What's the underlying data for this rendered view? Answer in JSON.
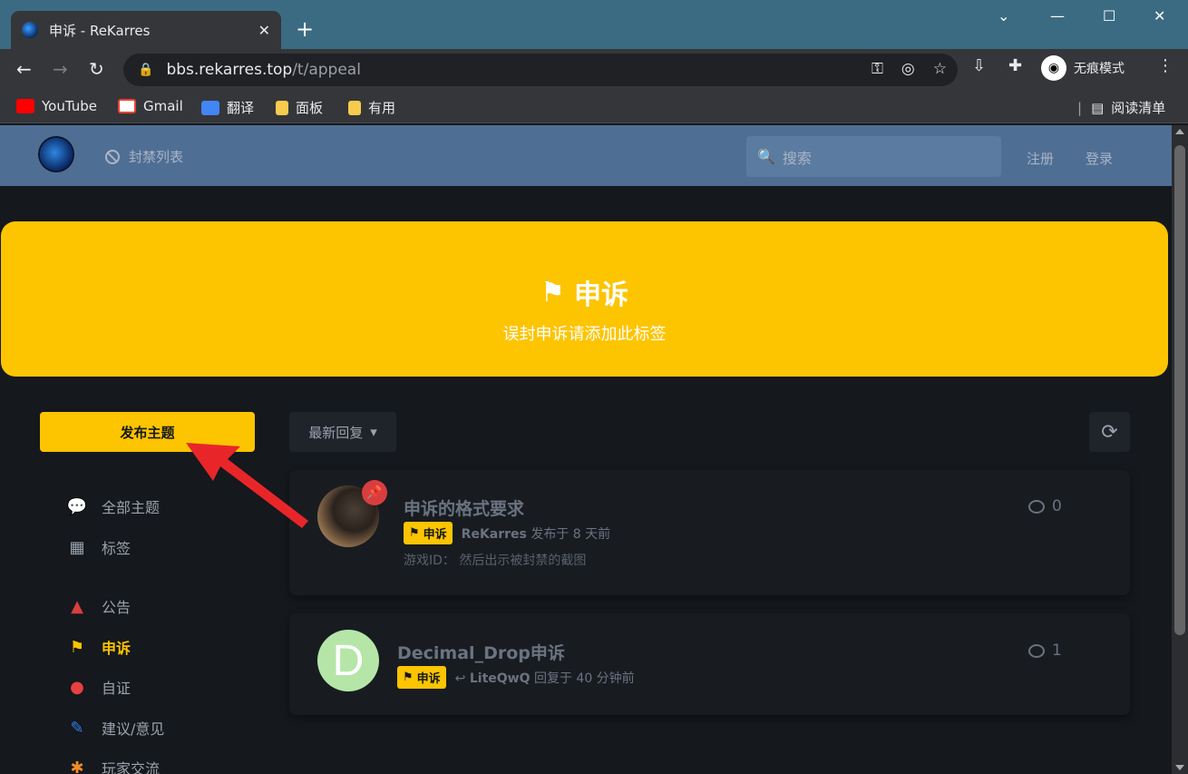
{
  "browser": {
    "tab_title": "申诉 - ReKarres",
    "url_host": "bbs.rekarres.top",
    "url_path": "/t/appeal",
    "incognito_label": "无痕模式",
    "bookmarks": [
      {
        "label": "YouTube",
        "icon": "youtube-icon"
      },
      {
        "label": "Gmail",
        "icon": "gmail-icon"
      },
      {
        "label": "翻译",
        "icon": "translate-icon"
      },
      {
        "label": "面板",
        "icon": "folder-icon"
      },
      {
        "label": "有用",
        "icon": "folder-icon"
      }
    ],
    "reading_list": "阅读清单"
  },
  "header": {
    "nav_ban_list": "封禁列表",
    "search_placeholder": "搜索",
    "register": "注册",
    "login": "登录"
  },
  "hero": {
    "title": "申诉",
    "description": "误封申诉请添加此标签",
    "color": "#fdc400"
  },
  "sidebar": {
    "start_discussion": "发布主题",
    "items": [
      {
        "label": "全部主题",
        "icon": "comments-icon"
      },
      {
        "label": "标签",
        "icon": "grid-icon"
      },
      {
        "label": "公告",
        "icon": "warning-icon"
      },
      {
        "label": "申诉",
        "icon": "flag-icon",
        "active": true
      },
      {
        "label": "自证",
        "icon": "mouse-icon"
      },
      {
        "label": "建议/意见",
        "icon": "syringe-icon"
      },
      {
        "label": "玩家交流",
        "icon": "person-icon"
      }
    ]
  },
  "list": {
    "sort_label": "最新回复",
    "discussions": [
      {
        "title": "申诉的格式要求",
        "tag": "申诉",
        "author": "ReKarres",
        "action": "发布于 8 天前",
        "excerpt": "游戏ID： 然后出示被封禁的截图",
        "replies": "0",
        "pinned": true
      },
      {
        "title": "Decimal_Drop申诉",
        "tag": "申诉",
        "author": "LiteQwQ",
        "action": "回复于 40 分钟前",
        "avatar_letter": "D",
        "replies": "1",
        "pinned": false
      }
    ]
  }
}
